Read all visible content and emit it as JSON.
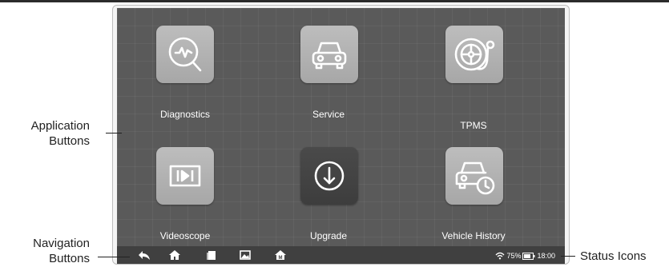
{
  "apps": [
    {
      "id": "diagnostics",
      "label": "Diagnostics",
      "icon": "diagnostics-icon"
    },
    {
      "id": "service",
      "label": "Service",
      "icon": "car-icon"
    },
    {
      "id": "tpms",
      "label": "TPMS",
      "icon": "tire-icon"
    },
    {
      "id": "videoscope",
      "label": "Videoscope",
      "icon": "video-icon"
    },
    {
      "id": "upgrade",
      "label": "Upgrade",
      "icon": "download-arrow-icon"
    },
    {
      "id": "vehicle_history",
      "label": "Vehicle History",
      "icon": "car-clock-icon"
    }
  ],
  "nav": [
    {
      "id": "back",
      "icon": "back-arrow-icon"
    },
    {
      "id": "home",
      "icon": "home-icon"
    },
    {
      "id": "recent",
      "icon": "recent-apps-icon"
    },
    {
      "id": "screenshot",
      "icon": "image-icon"
    },
    {
      "id": "maxi_home",
      "icon": "maxi-home-icon"
    }
  ],
  "status": {
    "battery": "75%",
    "time": "18:00"
  },
  "annotations": {
    "application_buttons": [
      "Application",
      "Buttons"
    ],
    "navigation_buttons": [
      "Navigation",
      "Buttons"
    ],
    "status_icons": "Status Icons"
  },
  "colors": {
    "screen": "#5a5a5a",
    "tile": "#b0b0b0",
    "tile_dark": "#444444",
    "navbar": "#404040"
  }
}
